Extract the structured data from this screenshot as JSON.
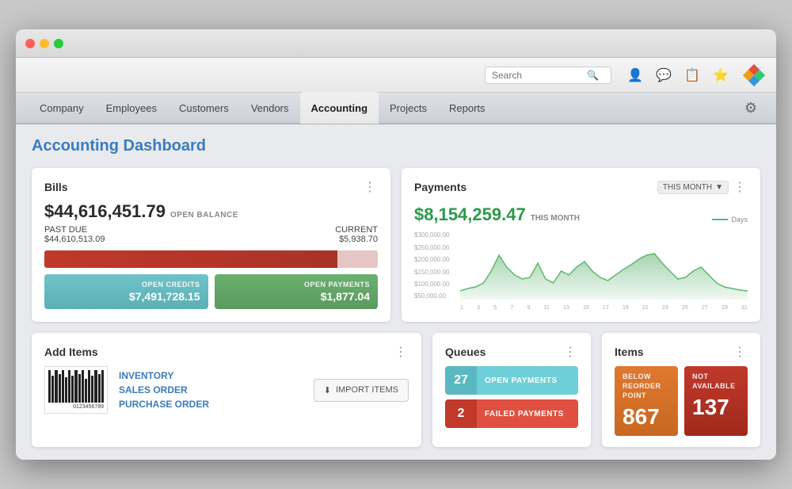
{
  "window": {
    "title": "Accounting Dashboard"
  },
  "toolbar": {
    "search_placeholder": "Search",
    "icons": [
      "person-icon",
      "chat-icon",
      "list-icon",
      "star-icon"
    ]
  },
  "nav": {
    "items": [
      {
        "label": "Company",
        "active": false
      },
      {
        "label": "Employees",
        "active": false
      },
      {
        "label": "Customers",
        "active": false
      },
      {
        "label": "Vendors",
        "active": false
      },
      {
        "label": "Accounting",
        "active": true
      },
      {
        "label": "Projects",
        "active": false
      },
      {
        "label": "Reports",
        "active": false
      }
    ]
  },
  "page_title": "Accounting Dashboard",
  "bills": {
    "title": "Bills",
    "amount": "$44,616,451.79",
    "open_balance_label": "OPEN BALANCE",
    "past_due_label": "PAST DUE",
    "past_due_value": "$44,610,513.09",
    "current_label": "CURRENT",
    "current_value": "$5,938.70",
    "open_credits_label": "OPEN CREDITS",
    "open_credits_value": "$7,491,728.15",
    "open_payments_label": "OPEN PAYMENTS",
    "open_payments_value": "$1,877.04",
    "progress_pct": 88
  },
  "payments": {
    "title": "Payments",
    "amount": "$8,154,259.47",
    "this_month_label": "THIS MONTH",
    "this_month_selector": "THIS MONTH",
    "days_legend": "Days",
    "y_labels": [
      "$300,000.00",
      "$250,000.00",
      "$200,000.00",
      "$150,000.00",
      "$100,000.00",
      "$50,000.00"
    ],
    "x_labels": [
      "1",
      "3",
      "5",
      "7",
      "9",
      "11",
      "13",
      "15",
      "17",
      "19",
      "21",
      "23",
      "25",
      "27",
      "29",
      "31"
    ]
  },
  "add_items": {
    "title": "Add Items",
    "links": [
      "INVENTORY",
      "SALES ORDER",
      "PURCHASE ORDER"
    ],
    "import_label": "IMPORT ITEMS",
    "barcode_number": "0123456789"
  },
  "queues": {
    "title": "Queues",
    "items": [
      {
        "count": "27",
        "label": "OPEN PAYMENTS",
        "color": "teal"
      },
      {
        "count": "2",
        "label": "FAILED PAYMENTS",
        "color": "red"
      }
    ]
  },
  "items": {
    "title": "Items",
    "boxes": [
      {
        "label": "BELOW REORDER POINT",
        "value": "867",
        "color": "orange"
      },
      {
        "label": "NOT AVAILABLE",
        "value": "137",
        "color": "red"
      }
    ]
  }
}
